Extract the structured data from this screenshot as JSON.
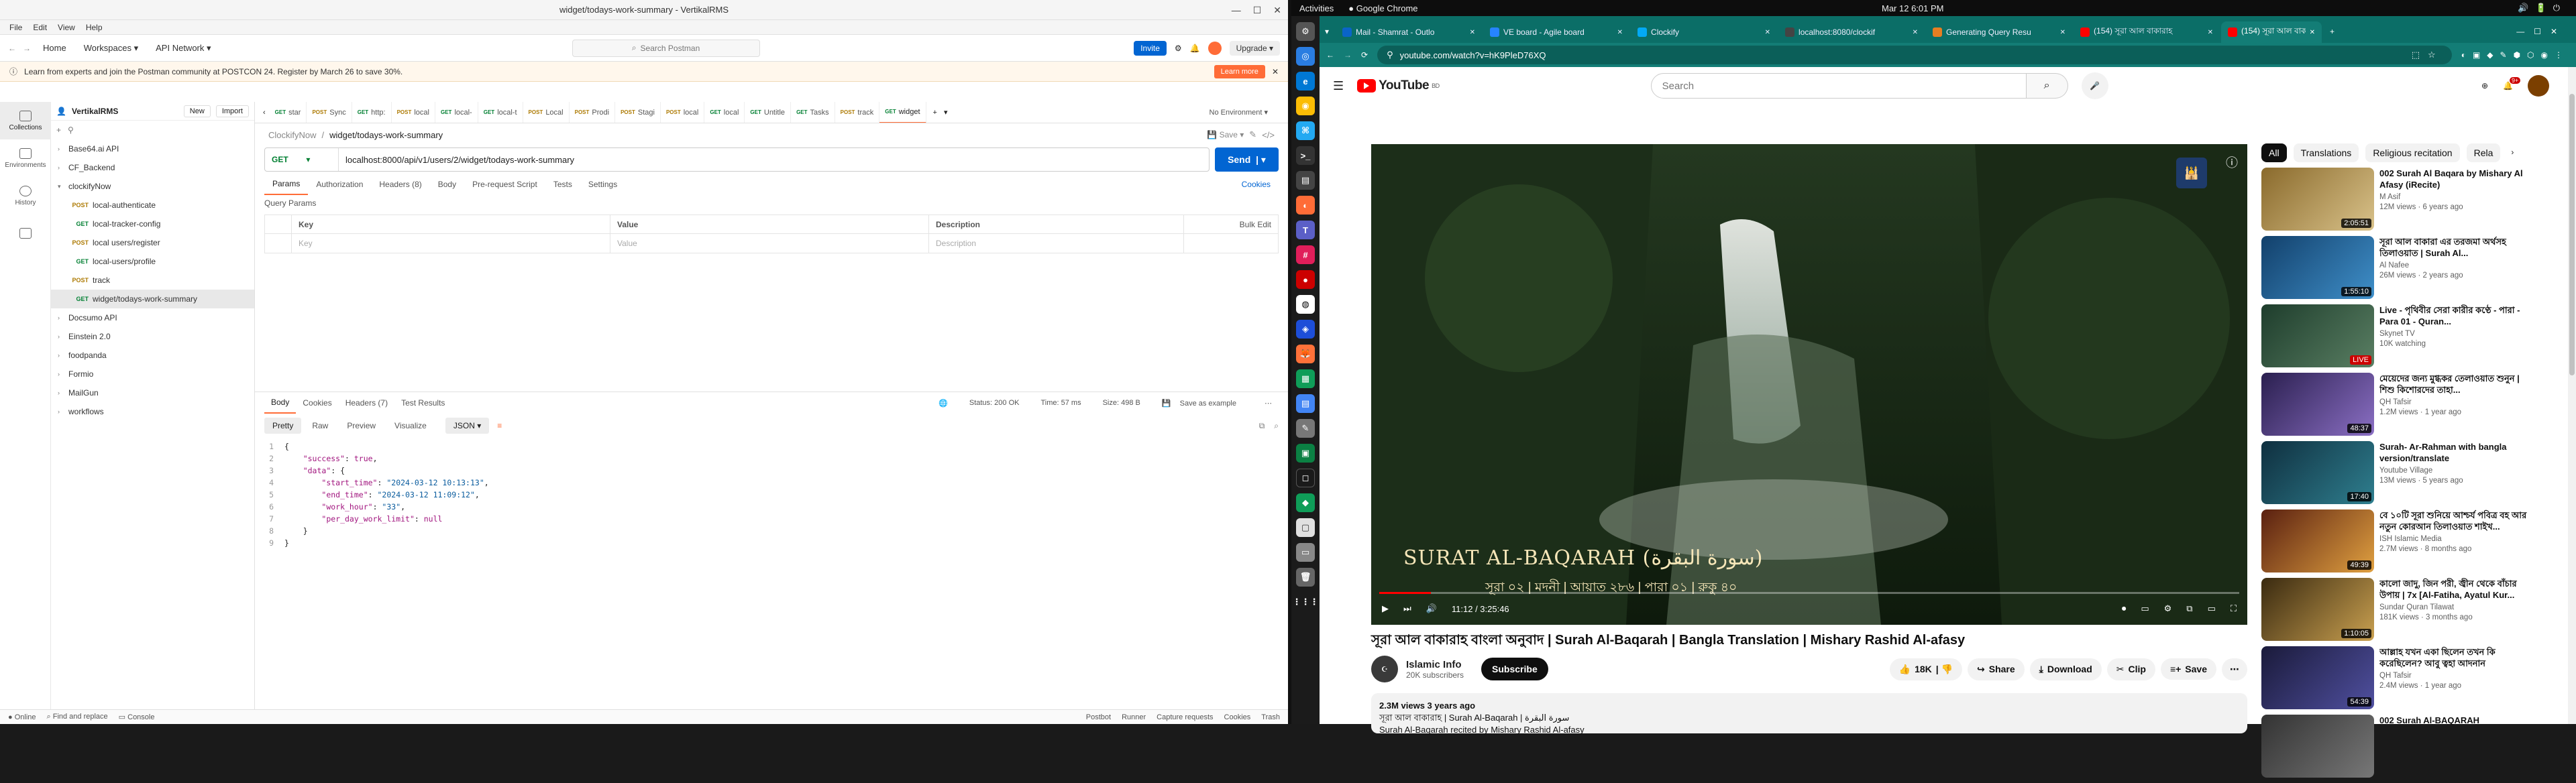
{
  "postman": {
    "window_title": "widget/todays-work-summary - VertikalRMS",
    "menu": [
      "File",
      "Edit",
      "View",
      "Help"
    ],
    "nav": {
      "home": "Home",
      "workspaces": "Workspaces",
      "api_network": "API Network"
    },
    "search_placeholder": "Search Postman",
    "invite": "Invite",
    "upgrade": "Upgrade",
    "banner_text": "Learn from experts and join the Postman community at POSTCON 24. Register by March 26 to save 30%.",
    "banner_button": "Learn more",
    "workspace_name": "VertikalRMS",
    "new_btn": "New",
    "import_btn": "Import",
    "rail": [
      "Collections",
      "Environments",
      "History"
    ],
    "tree": [
      {
        "label": "Base64.ai API",
        "type": "folder",
        "depth": 0
      },
      {
        "label": "CF_Backend",
        "type": "folder",
        "depth": 0
      },
      {
        "label": "clockifyNow",
        "type": "folder-open",
        "depth": 0
      },
      {
        "label": "local-authenticate",
        "method": "POST",
        "depth": 1
      },
      {
        "label": "local-tracker-config",
        "method": "GET",
        "depth": 1
      },
      {
        "label": "local users/register",
        "method": "POST",
        "depth": 1
      },
      {
        "label": "local-users/profile",
        "method": "GET",
        "depth": 1
      },
      {
        "label": "track",
        "method": "POST",
        "depth": 1
      },
      {
        "label": "widget/todays-work-summary",
        "method": "GET",
        "depth": 1,
        "selected": true
      },
      {
        "label": "Docsumo API",
        "type": "folder",
        "depth": 0
      },
      {
        "label": "Einstein 2.0",
        "type": "folder",
        "depth": 0
      },
      {
        "label": "foodpanda",
        "type": "folder",
        "depth": 0
      },
      {
        "label": "Formio",
        "type": "folder",
        "depth": 0
      },
      {
        "label": "MailGun",
        "type": "folder",
        "depth": 0
      },
      {
        "label": "workflows",
        "type": "folder",
        "depth": 0
      }
    ],
    "req_tabs": [
      {
        "m": "GET",
        "label": "star"
      },
      {
        "m": "POST",
        "label": "Sync"
      },
      {
        "m": "GET",
        "label": "http:"
      },
      {
        "m": "POST",
        "label": "local"
      },
      {
        "m": "GET",
        "label": "local-"
      },
      {
        "m": "GET",
        "label": "local-t"
      },
      {
        "m": "POST",
        "label": "Local"
      },
      {
        "m": "POST",
        "label": "Prodi"
      },
      {
        "m": "POST",
        "label": "Stagi"
      },
      {
        "m": "POST",
        "label": "local"
      },
      {
        "m": "GET",
        "label": "local"
      },
      {
        "m": "GET",
        "label": "Untitle"
      },
      {
        "m": "GET",
        "label": "Tasks"
      },
      {
        "m": "POST",
        "label": "track"
      },
      {
        "m": "GET",
        "label": "widget"
      }
    ],
    "env": "No Environment",
    "breadcrumb": {
      "collection": "ClockifyNow",
      "request": "widget/todays-work-summary"
    },
    "save": "Save",
    "method": "GET",
    "url": "localhost:8000/api/v1/users/2/widget/todays-work-summary",
    "send": "Send",
    "request_tabs": [
      "Params",
      "Authorization",
      "Headers (8)",
      "Body",
      "Pre-request Script",
      "Tests",
      "Settings"
    ],
    "cookies": "Cookies",
    "query_params_title": "Query Params",
    "qp_headers": {
      "key": "Key",
      "value": "Value",
      "description": "Description",
      "bulk": "Bulk Edit"
    },
    "qp_placeholders": {
      "key": "Key",
      "value": "Value",
      "description": "Description"
    },
    "response_tabs": [
      "Body",
      "Cookies",
      "Headers (7)",
      "Test Results"
    ],
    "status": {
      "code": "Status: 200 OK",
      "time": "Time: 57 ms",
      "size": "Size: 498 B",
      "save": "Save as example"
    },
    "view_modes": [
      "Pretty",
      "Raw",
      "Preview",
      "Visualize"
    ],
    "format": "JSON",
    "code_lines": [
      "{",
      "    \"success\": true,",
      "    \"data\": {",
      "        \"start_time\": \"2024-03-12 10:13:13\",",
      "        \"end_time\": \"2024-03-12 11:09:12\",",
      "        \"work_hour\": \"33\",",
      "        \"per_day_work_limit\": null",
      "    }",
      "}"
    ],
    "footer_left": [
      "Online",
      "Find and replace",
      "Console"
    ],
    "footer_right": [
      "Postbot",
      "Runner",
      "Capture requests",
      "Cookies",
      "Trash"
    ]
  },
  "desktop": {
    "activities": "Activities",
    "app": "Google Chrome",
    "clock": "Mar 12  6:01 PM"
  },
  "chrome": {
    "tabs": [
      {
        "title": "Mail - Shamrat - Outlo",
        "color": "#0a64c8"
      },
      {
        "title": "VE board - Agile board",
        "color": "#2684ff"
      },
      {
        "title": "Clockify",
        "color": "#03a9f4"
      },
      {
        "title": "localhost:8080/clockif",
        "color": "#444444"
      },
      {
        "title": "Generating Query Resu",
        "color": "#e67e22"
      },
      {
        "title": "(154) সূরা আল বাকারাহ",
        "color": "#ff0000"
      },
      {
        "title": "(154) সূরা আল বাকারাহ",
        "color": "#ff0000",
        "active": true
      }
    ],
    "url": "youtube.com/watch?v=hK9PleD76XQ"
  },
  "youtube": {
    "logo": "YouTube",
    "country": "BD",
    "search_placeholder": "Search",
    "notif_count": "9+",
    "video_title": "সূরা আল বাকারাহ বাংলা অনুবাদ | Surah Al-Baqarah | Bangla Translation | Mishary Rashid Al-afasy",
    "overlay_title": "SURAT AL-BAQARAH (سورة البقرة)",
    "overlay_sub": "সূরা ০২ | মদনী | আয়াত ২৮৬ | পারা ০১ | রুকু ৪০",
    "time": "11:12 / 3:25:46",
    "progress": 0.06,
    "channel": "Islamic Info",
    "subs": "20K subscribers",
    "subscribe": "Subscribe",
    "likes": "18K",
    "share": "Share",
    "download": "Download",
    "clip": "Clip",
    "save": "Save",
    "views": "2.3M views  3 years ago",
    "desc1": "সূরা আল বাকারাহ | Surah Al-Baqarah | سورة البقرة",
    "desc2": "Surah Al-Baqarah recited by Mishary Rashid Al-afasy",
    "chips": [
      "All",
      "Translations",
      "Religious recitation",
      "Rela"
    ],
    "recs": [
      {
        "title": "002 Surah Al Baqara by Mishary Al Afasy (iRecite)",
        "channel": "M Asif",
        "meta": "12M views · 6 years ago",
        "dur": "2:05:51",
        "c1": "#8a6a2c",
        "c2": "#d9c28a"
      },
      {
        "title": "সূরা আল বাকারা এর তরজমা অর্থসহ তিলাওয়াত | Surah Al...",
        "channel": "Al Nafee",
        "meta": "26M views · 2 years ago",
        "dur": "1:55:10",
        "c1": "#12406b",
        "c2": "#3f8fc9"
      },
      {
        "title": "Live - পৃথিবীর সেরা কারীর কণ্ঠে - পারা - Para 01 - Quran...",
        "channel": "Skynet TV",
        "meta": "10K watching",
        "dur": "LIVE",
        "c1": "#1e3d2c",
        "c2": "#5a7f63"
      },
      {
        "title": "মেয়েদের জন্য মুগ্ধকর তেলাওয়াত শুনুন | শিশু কিশোরদের তাহা...",
        "channel": "QH Tafsir",
        "meta": "1.2M views · 1 year ago",
        "dur": "48:37",
        "c1": "#2a1f4f",
        "c2": "#8b6fc4"
      },
      {
        "title": "Surah- Ar-Rahman with bangla version/translate",
        "channel": "Youtube Village",
        "meta": "13M views · 5 years ago",
        "dur": "17:40",
        "c1": "#0f2f3f",
        "c2": "#2f7f8f"
      },
      {
        "title": "বে ১০টি সূরা শুনিয়ে আশ্চর্য পবিত্র বহ আর নতুন কোরআন তিলাওয়াত শাইখ...",
        "channel": "ISH Islamic Media",
        "meta": "2.7M views · 8 months ago",
        "dur": "49:39",
        "c1": "#5a2010",
        "c2": "#e0a040"
      },
      {
        "title": "কালো জাদু, জিন পরী, জ্বীন থেকে বাঁচার উপায় | 7x [Al-Fatiha, Ayatul Kur...",
        "channel": "Sundar Quran Tilawat",
        "meta": "181K views · 3 months ago",
        "dur": "1:10:05",
        "c1": "#3a2a10",
        "c2": "#c9a050"
      },
      {
        "title": "আল্লাহ যখন একা ছিলেন তখন কি করেছিলেন? আবু ত্বহা আদনান",
        "channel": "QH Tafsir",
        "meta": "2.4M views · 1 year ago",
        "dur": "54:39",
        "c1": "#1a1a3a",
        "c2": "#5050a0"
      },
      {
        "title": "002 Surah Al-BAQARAH",
        "channel": "",
        "meta": "",
        "dur": "",
        "c1": "#333",
        "c2": "#777"
      }
    ]
  }
}
